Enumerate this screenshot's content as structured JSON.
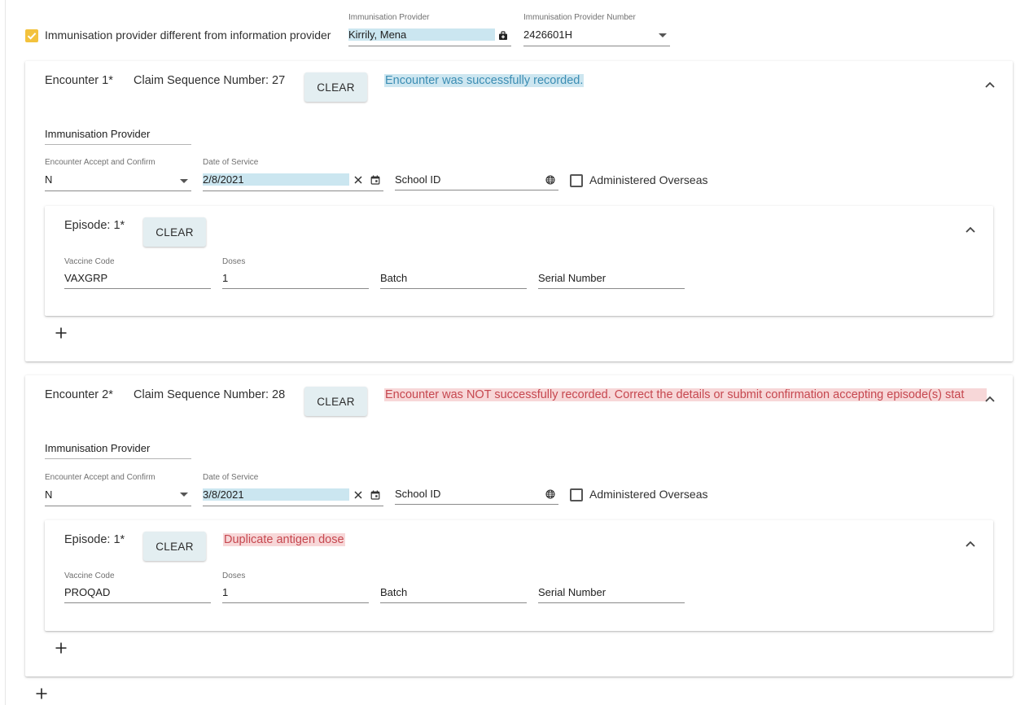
{
  "top": {
    "checkbox_label": "Immunisation provider different from information provider",
    "provider_label": "Immunisation Provider",
    "provider_value": "Kirrily, Mena",
    "provider_number_label": "Immunisation Provider Number",
    "provider_number_value": "2426601H"
  },
  "encounters": [
    {
      "title": "Encounter 1*",
      "claim_seq": "Claim Sequence Number: 27",
      "clear_label": "CLEAR",
      "message": "Encounter was successfully recorded.",
      "provider_placeholder": "Immunisation Provider",
      "accept_label": "Encounter Accept and Confirm",
      "accept_value": "N",
      "date_label": "Date of Service",
      "date_value": "2/8/2021",
      "school_placeholder": "School ID",
      "overseas_label": "Administered Overseas",
      "episode": {
        "title": "Episode: 1*",
        "clear_label": "CLEAR",
        "message": "",
        "vaccine_label": "Vaccine Code",
        "vaccine_value": "VAXGRP",
        "doses_label": "Doses",
        "doses_value": "1",
        "batch_placeholder": "Batch",
        "serial_placeholder": "Serial Number"
      }
    },
    {
      "title": "Encounter 2*",
      "claim_seq": "Claim Sequence Number: 28",
      "clear_label": "CLEAR",
      "message": "Encounter was NOT successfully recorded. Correct the details or submit confirmation accepting episode(s) stat",
      "provider_placeholder": "Immunisation Provider",
      "accept_label": "Encounter Accept and Confirm",
      "accept_value": "N",
      "date_label": "Date of Service",
      "date_value": "3/8/2021",
      "school_placeholder": "School ID",
      "overseas_label": "Administered Overseas",
      "episode": {
        "title": "Episode: 1*",
        "clear_label": "CLEAR",
        "message": "Duplicate antigen dose",
        "vaccine_label": "Vaccine Code",
        "vaccine_value": "PROQAD",
        "doses_label": "Doses",
        "doses_value": "1",
        "batch_placeholder": "Batch",
        "serial_placeholder": "Serial Number"
      }
    }
  ],
  "colors": {
    "accent_checkbox": "#f3c23d",
    "highlight_blue": "#cbe6f0",
    "success_text": "#3b8db3",
    "error_text": "#c6474f",
    "error_bg": "#f7d7d8",
    "button_bg": "#e3eef1"
  },
  "icons": [
    "checkmark-icon",
    "medical-bag-icon",
    "dropdown-arrow-icon",
    "clear-x-icon",
    "calendar-icon",
    "globe-icon",
    "chevron-up-icon",
    "plus-icon"
  ]
}
